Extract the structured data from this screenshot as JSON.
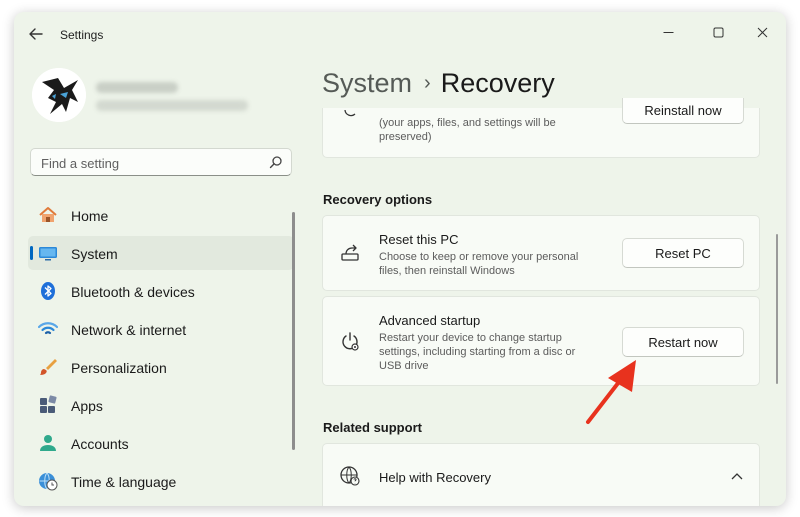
{
  "app": {
    "title": "Settings"
  },
  "search": {
    "placeholder": "Find a setting"
  },
  "nav": {
    "items": [
      {
        "label": "Home",
        "icon": "home-icon"
      },
      {
        "label": "System",
        "icon": "system-icon",
        "active": true
      },
      {
        "label": "Bluetooth & devices",
        "icon": "bluetooth-icon"
      },
      {
        "label": "Network & internet",
        "icon": "wifi-icon"
      },
      {
        "label": "Personalization",
        "icon": "brush-icon"
      },
      {
        "label": "Apps",
        "icon": "apps-icon"
      },
      {
        "label": "Accounts",
        "icon": "person-icon"
      },
      {
        "label": "Time & language",
        "icon": "globe-clock-icon"
      }
    ]
  },
  "breadcrumb": {
    "parent": "System",
    "separator": "›",
    "current": "Recovery"
  },
  "partial_card": {
    "desc_line1": "(your apps, files, and settings will be",
    "desc_line2": "preserved)",
    "button": "Reinstall now"
  },
  "recovery_options": {
    "header": "Recovery options",
    "reset": {
      "title": "Reset this PC",
      "desc": "Choose to keep or remove your personal files, then reinstall Windows",
      "button": "Reset PC"
    },
    "advanced": {
      "title": "Advanced startup",
      "desc": "Restart your device to change startup settings, including starting from a disc or USB drive",
      "button": "Restart now"
    }
  },
  "related_support": {
    "header": "Related support",
    "help": {
      "title": "Help with Recovery"
    }
  },
  "colors": {
    "accent": "#0067c0",
    "annotation_arrow": "#e8321e",
    "window_bg": "#eef4ea"
  }
}
